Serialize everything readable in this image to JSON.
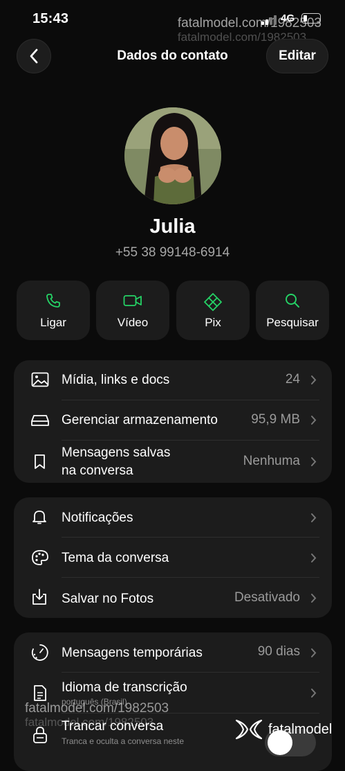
{
  "status_bar": {
    "time": "15:43",
    "network": "4G",
    "battery_level": 0.25
  },
  "watermark": {
    "top": "fatalmodel.com/1982503",
    "bottom": "fatalmodel.com/1982503",
    "brand": "fatalmodel"
  },
  "header": {
    "title": "Dados do contato",
    "edit_label": "Editar"
  },
  "contact": {
    "name": "Julia",
    "phone": "+55 38 99148-6914"
  },
  "actions": [
    {
      "label": "Ligar",
      "icon": "phone-icon"
    },
    {
      "label": "Vídeo",
      "icon": "video-icon"
    },
    {
      "label": "Pix",
      "icon": "pix-icon"
    },
    {
      "label": "Pesquisar",
      "icon": "search-icon"
    }
  ],
  "accent_color": "#25d366",
  "media_section": {
    "media": {
      "label": "Mídia, links e docs",
      "value": "24"
    },
    "storage": {
      "label": "Gerenciar armazenamento",
      "value": "95,9 MB"
    },
    "saved": {
      "label_line1": "Mensagens salvas",
      "label_line2": "na conversa",
      "value": "Nenhuma"
    }
  },
  "settings_section": {
    "notifications": {
      "label": "Notificações",
      "value": ""
    },
    "theme": {
      "label": "Tema da conversa",
      "value": ""
    },
    "save_photos": {
      "label": "Salvar no Fotos",
      "value": "Desativado"
    }
  },
  "privacy_section": {
    "disappearing": {
      "label": "Mensagens temporárias",
      "value": "90 dias"
    },
    "transcription": {
      "label": "Idioma de transcrição",
      "sub": "português (Brasil)"
    },
    "lock": {
      "label": "Trancar conversa",
      "sub": "Tranca e oculta a conversa neste",
      "toggle_on": false
    }
  }
}
